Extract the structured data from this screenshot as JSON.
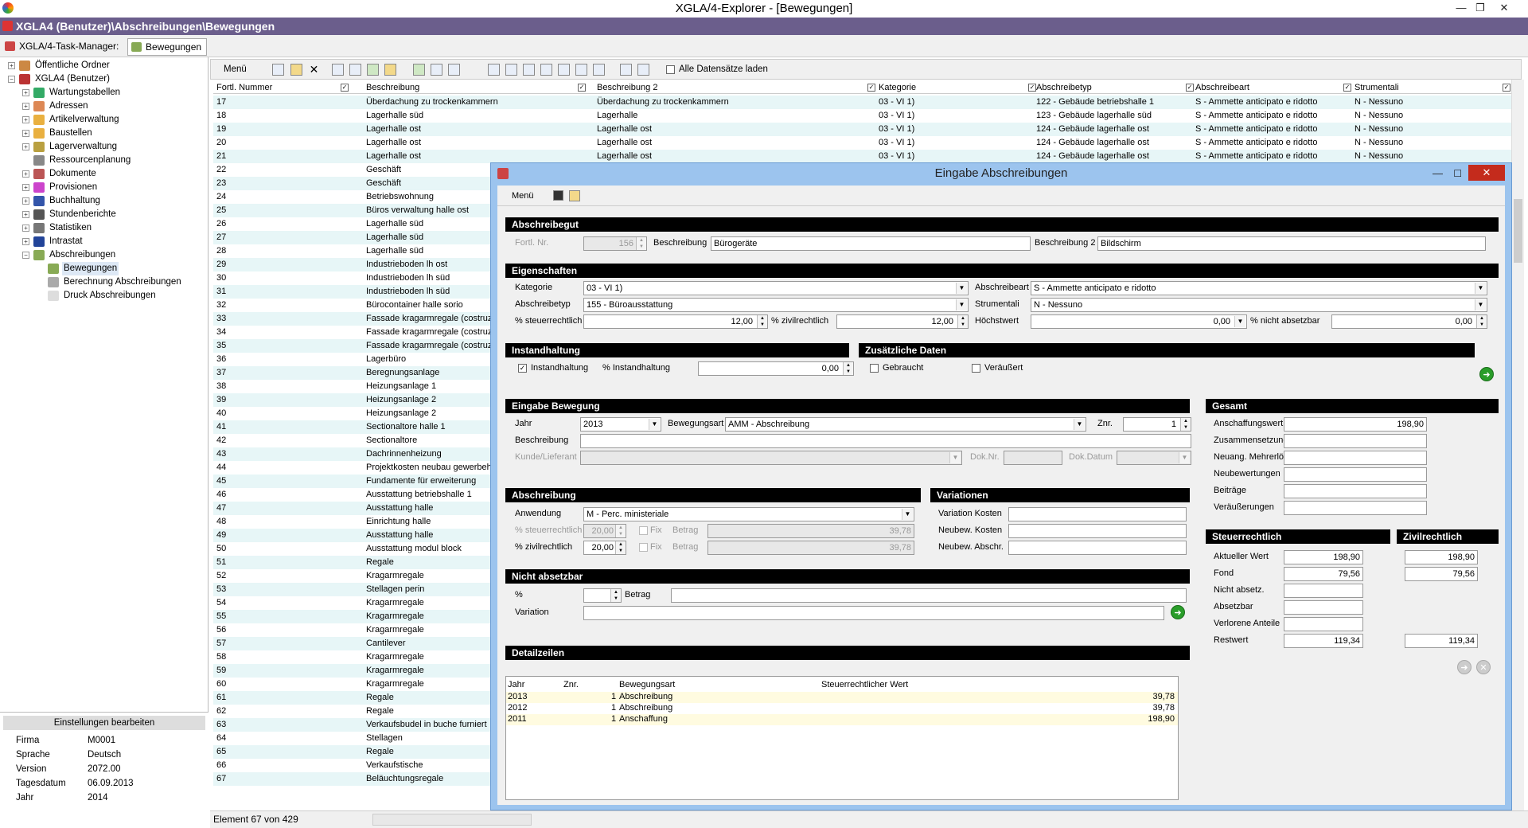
{
  "app": {
    "title": "XGLA/4-Explorer - [Bewegungen]",
    "path": "XGLA4 (Benutzer)\\Abschreibungen\\Bewegungen",
    "task_manager_tab": "XGLA/4-Task-Manager:",
    "active_tab": "Bewegungen"
  },
  "tree": [
    {
      "label": "Öffentliche Ordner",
      "level": 0,
      "exp": "+",
      "color": "#c84"
    },
    {
      "label": "XGLA4 (Benutzer)",
      "level": 0,
      "exp": "−",
      "color": "#b33"
    },
    {
      "label": "Wartungstabellen",
      "level": 1,
      "exp": "+",
      "color": "#3a6"
    },
    {
      "label": "Adressen",
      "level": 1,
      "exp": "+",
      "color": "#d85"
    },
    {
      "label": "Artikelverwaltung",
      "level": 1,
      "exp": "+",
      "color": "#e9b040"
    },
    {
      "label": "Baustellen",
      "level": 1,
      "exp": "+",
      "color": "#e9b040"
    },
    {
      "label": "Lagerverwaltung",
      "level": 1,
      "exp": "+",
      "color": "#b9a040"
    },
    {
      "label": "Ressourcenplanung",
      "level": 1,
      "exp": "",
      "color": "#888"
    },
    {
      "label": "Dokumente",
      "level": 1,
      "exp": "+",
      "color": "#b55"
    },
    {
      "label": "Provisionen",
      "level": 1,
      "exp": "+",
      "color": "#c4c"
    },
    {
      "label": "Buchhaltung",
      "level": 1,
      "exp": "+",
      "color": "#35a"
    },
    {
      "label": "Stundenberichte",
      "level": 1,
      "exp": "+",
      "color": "#555"
    },
    {
      "label": "Statistiken",
      "level": 1,
      "exp": "+",
      "color": "#777"
    },
    {
      "label": "Intrastat",
      "level": 1,
      "exp": "+",
      "color": "#249"
    },
    {
      "label": "Abschreibungen",
      "level": 1,
      "exp": "−",
      "color": "#8a5"
    },
    {
      "label": "Bewegungen",
      "level": 2,
      "exp": "",
      "color": "#8a5",
      "selected": true
    },
    {
      "label": "Berechnung Abschreibungen",
      "level": 2,
      "exp": "",
      "color": "#aaa"
    },
    {
      "label": "Druck Abschreibungen",
      "level": 2,
      "exp": "",
      "color": "#ddd"
    }
  ],
  "settings": {
    "header": "Einstellungen bearbeiten",
    "rows": [
      {
        "key": "Firma",
        "value": "M0001"
      },
      {
        "key": "Sprache",
        "value": "Deutsch"
      },
      {
        "key": "Version",
        "value": "2072.00"
      },
      {
        "key": "Tagesdatum",
        "value": "06.09.2013"
      },
      {
        "key": "Jahr",
        "value": "2014"
      }
    ]
  },
  "list": {
    "menu_label": "Menü",
    "load_all_label": "Alle Datensätze laden",
    "columns": [
      "Fortl. Nummer",
      "Beschreibung",
      "Beschreibung 2",
      "Kategorie",
      "Abschreibetyp",
      "Abschreibeart",
      "Strumentali"
    ],
    "rows": [
      [
        "17",
        "Überdachung zu trockenkammern",
        "Überdachung zu trockenkammern",
        "03 - VI 1)",
        "122 -  Gebäude betriebshalle 1",
        "S - Ammette anticipato e ridotto",
        "N - Nessuno"
      ],
      [
        "18",
        "Lagerhalle süd",
        "Lagerhalle",
        "03 - VI 1)",
        "123 -  Gebäude lagerhalle süd",
        "S - Ammette anticipato e ridotto",
        "N - Nessuno"
      ],
      [
        "19",
        "Lagerhalle ost",
        "Lagerhalle ost",
        "03 - VI 1)",
        "124 -  Gebäude lagerhalle ost",
        "S - Ammette anticipato e ridotto",
        "N - Nessuno"
      ],
      [
        "20",
        "Lagerhalle ost",
        "Lagerhalle ost",
        "03 - VI 1)",
        "124 -  Gebäude lagerhalle ost",
        "S - Ammette anticipato e ridotto",
        "N - Nessuno"
      ],
      [
        "21",
        "Lagerhalle ost",
        "Lagerhalle ost",
        "03 - VI 1)",
        "124 -  Gebäude lagerhalle ost",
        "S - Ammette anticipato e ridotto",
        "N - Nessuno"
      ],
      [
        "22",
        "Geschäft"
      ],
      [
        "23",
        "Geschäft"
      ],
      [
        "24",
        "Betriebswohnung"
      ],
      [
        "25",
        "Büros verwaltung halle ost"
      ],
      [
        "26",
        "Lagerhalle süd"
      ],
      [
        "27",
        "Lagerhalle süd"
      ],
      [
        "28",
        "Lagerhalle süd"
      ],
      [
        "29",
        "Industrieboden lh ost"
      ],
      [
        "30",
        "Industrieboden lh süd"
      ],
      [
        "31",
        "Industrieboden lh süd"
      ],
      [
        "32",
        "Bürocontainer halle sorio"
      ],
      [
        "33",
        "Fassade kragarmregale (costruzione"
      ],
      [
        "34",
        "Fassade kragarmregale (costruzione"
      ],
      [
        "35",
        "Fassade kragarmregale (costruzione"
      ],
      [
        "36",
        "Lagerbüro"
      ],
      [
        "37",
        "Beregnungsanlage"
      ],
      [
        "38",
        "Heizungsanlage 1"
      ],
      [
        "39",
        "Heizungsanlage 2"
      ],
      [
        "40",
        "Heizungsanlage 2"
      ],
      [
        "41",
        "Sectionaltore halle 1"
      ],
      [
        "42",
        "Sectionaltore"
      ],
      [
        "43",
        "Dachrinnenheizung"
      ],
      [
        "44",
        "Projektkosten neubau gewerbehalle"
      ],
      [
        "45",
        "Fundamente für erweiterung"
      ],
      [
        "46",
        "Ausstattung betriebshalle 1"
      ],
      [
        "47",
        "Ausstattung halle"
      ],
      [
        "48",
        "Einrichtung halle"
      ],
      [
        "49",
        "Ausstattung halle"
      ],
      [
        "50",
        "Ausstattung modul block"
      ],
      [
        "51",
        "Regale"
      ],
      [
        "52",
        "Kragarmregale"
      ],
      [
        "53",
        "Stellagen perin"
      ],
      [
        "54",
        "Kragarmregale"
      ],
      [
        "55",
        "Kragarmregale"
      ],
      [
        "56",
        "Kragarmregale"
      ],
      [
        "57",
        "Cantilever"
      ],
      [
        "58",
        "Kragarmregale"
      ],
      [
        "59",
        "Kragarmregale"
      ],
      [
        "60",
        "Kragarmregale"
      ],
      [
        "61",
        "Regale"
      ],
      [
        "62",
        "Regale"
      ],
      [
        "63",
        "Verkaufsbudel in buche furniert"
      ],
      [
        "64",
        "Stellagen"
      ],
      [
        "65",
        "Regale"
      ],
      [
        "66",
        "Verkaufstische"
      ],
      [
        "67",
        "Beläuchtungsregale"
      ]
    ],
    "status": "Element 67 von 429"
  },
  "dialog": {
    "title": "Eingabe Abschreibungen",
    "close_glyph": "✕",
    "menu_label": "Menü",
    "abschreibegut": {
      "header": "Abschreibegut",
      "fortl_label": "Fortl. Nr.",
      "fortl_value": "156",
      "beschr_label": "Beschreibung",
      "beschr_value": "Bürogeräte",
      "beschr2_label": "Beschreibung 2",
      "beschr2_value": "Bildschirm"
    },
    "eigenschaften": {
      "header": "Eigenschaften",
      "kategorie_label": "Kategorie",
      "kategorie_value": "03 - VI 1)",
      "abschreibeart_label": "Abschreibeart",
      "abschreibeart_value": "S - Ammette anticipato e ridotto",
      "abschreibetyp_label": "Abschreibetyp",
      "abschreibetyp_value": "155 - Büroausstattung",
      "strumentali_label": "Strumentali",
      "strumentali_value": "N - Nessuno",
      "steuer_label": "% steuerrechtlich",
      "steuer_value": "12,00",
      "zivil_label": "% zivilrechtlich",
      "zivil_value": "12,00",
      "hoechst_label": "Höchstwert",
      "hoechst_value": "0,00",
      "nicht_abs_label": "% nicht absetzbar",
      "nicht_abs_value": "0,00"
    },
    "instandhaltung": {
      "header": "Instandhaltung",
      "chk_label": "Instandhaltung",
      "checked": "✓",
      "pct_label": "% Instandhaltung",
      "pct_value": "0,00"
    },
    "zusatz": {
      "header": "Zusätzliche Daten",
      "gebraucht": "Gebraucht",
      "veraeussert": "Veräußert"
    },
    "eingabe": {
      "header": "Eingabe Bewegung",
      "jahr_label": "Jahr",
      "jahr_value": "2013",
      "bewart_label": "Bewegungsart",
      "bewart_value": "AMM - Abschreibung",
      "znr_label": "Znr.",
      "znr_value": "1",
      "beschr_label": "Beschreibung",
      "kunde_label": "Kunde/Lieferant",
      "doknr_label": "Dok.Nr.",
      "dokdatum_label": "Dok.Datum"
    },
    "abschreibung": {
      "header": "Abschreibung",
      "anwendung_label": "Anwendung",
      "anwendung_value": "M - Perc. ministeriale",
      "steuer_label": "% steuerrechtlich",
      "steuer_value": "20,00",
      "zivil_label": "% zivilrechtlich",
      "zivil_value": "20,00",
      "fix_label": "Fix",
      "betrag_label": "Betrag",
      "betrag1": "39,78",
      "betrag2": "39,78"
    },
    "variationen": {
      "header": "Variationen",
      "rows": [
        "Variation Kosten",
        "Neubew. Kosten",
        "Neubew. Abschr."
      ]
    },
    "nicht_absetzbar": {
      "header": "Nicht absetzbar",
      "pct_label": "%",
      "betrag_label": "Betrag",
      "variation_label": "Variation"
    },
    "detail": {
      "header": "Detailzeilen",
      "columns": [
        "Jahr",
        "Znr.",
        "Bewegungsart",
        "Steuerrechtlicher Wert"
      ],
      "rows": [
        {
          "jahr": "2013",
          "znr": "1",
          "art": "Abschreibung",
          "wert": "39,78"
        },
        {
          "jahr": "2012",
          "znr": "1",
          "art": "Abschreibung",
          "wert": "39,78"
        },
        {
          "jahr": "2011",
          "znr": "1",
          "art": "Anschaffung",
          "wert": "198,90"
        }
      ]
    },
    "gesamt": {
      "header": "Gesamt",
      "rows": [
        {
          "label": "Anschaffungswert",
          "value": "198,90"
        },
        {
          "label": "Zusammensetzungen",
          "value": ""
        },
        {
          "label": "Neuang. Mehrerlöse",
          "value": ""
        },
        {
          "label": "Neubewertungen",
          "value": ""
        },
        {
          "label": "Beiträge",
          "value": ""
        },
        {
          "label": "Veräußerungen",
          "value": ""
        }
      ]
    },
    "steuerrechtlich": {
      "header": "Steuerrechtlich",
      "rows": [
        {
          "label": "Aktueller Wert",
          "value": "198,90"
        },
        {
          "label": "Fond",
          "value": "79,56"
        },
        {
          "label": "Nicht absetz.",
          "value": ""
        },
        {
          "label": "Absetzbar",
          "value": ""
        },
        {
          "label": "Verlorene Anteile",
          "value": ""
        },
        {
          "label": "Restwert",
          "value": "119,34"
        }
      ]
    },
    "zivilrechtlich": {
      "header": "Zivilrechtlich",
      "aktueller": "198,90",
      "fond": "79,56",
      "restwert": "119,34"
    }
  }
}
